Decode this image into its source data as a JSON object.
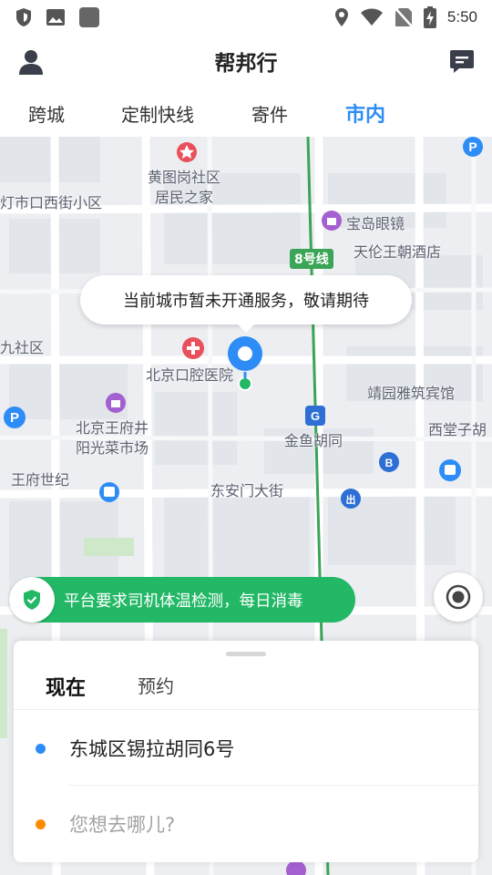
{
  "status": {
    "time": "5:50",
    "left_icons": [
      "shield-icon",
      "image-icon",
      "app-icon"
    ],
    "right_icons": [
      "location-icon",
      "wifi-icon",
      "no-sim-icon",
      "battery-charging-icon"
    ]
  },
  "header": {
    "title": "帮邦行",
    "left_icon": "avatar-icon",
    "right_icon": "message-icon"
  },
  "tabs": [
    {
      "label": "跨城",
      "active": false
    },
    {
      "label": "定制快线",
      "active": false
    },
    {
      "label": "寄件",
      "active": false
    },
    {
      "label": "市内",
      "active": true
    }
  ],
  "map": {
    "labels": [
      {
        "text": "黄图岗社区"
      },
      {
        "text": "居民之家"
      },
      {
        "text": "灯市口西街小区"
      },
      {
        "text": "宝岛眼镜"
      },
      {
        "text": "天伦王朝酒店"
      },
      {
        "text": "九社区"
      },
      {
        "text": "北京口腔医院"
      },
      {
        "text": "靖园雅筑宾馆"
      },
      {
        "text": "北京王府井"
      },
      {
        "text": "阳光菜市场"
      },
      {
        "text": "金鱼胡同"
      },
      {
        "text": "西堂子胡"
      },
      {
        "text": "王府世纪"
      },
      {
        "text": "东安门大街"
      }
    ],
    "line_badge": "8号线",
    "bubble": "当前城市暂未开通服务，敬请期待",
    "accent_blue": "#2e8cf6",
    "accent_green": "#23b865"
  },
  "notice": {
    "text": "平台要求司机体温检测，每日消毒",
    "icon": "shield-check-icon"
  },
  "locate": {
    "icon": "locate-icon"
  },
  "card": {
    "mode_now": "现在",
    "mode_later": "预约",
    "from": "东城区锡拉胡同6号",
    "to_placeholder": "您想去哪儿?",
    "from_dot_color": "#2e8cf6",
    "to_dot_color": "#ff8a00"
  }
}
